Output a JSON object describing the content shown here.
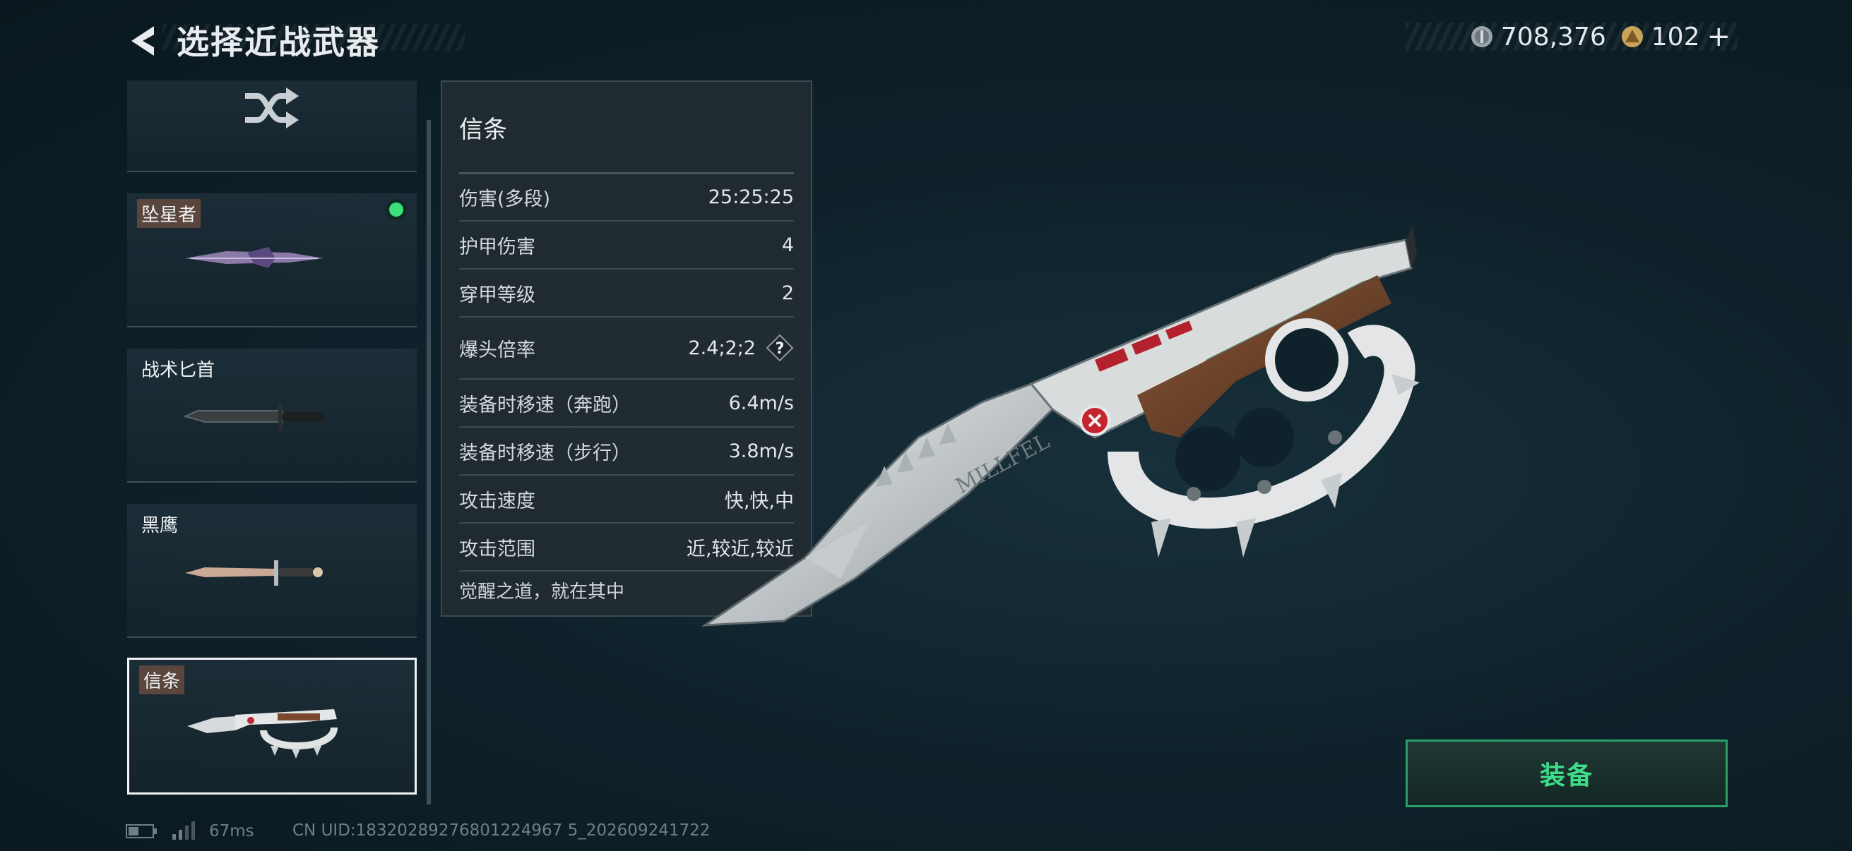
{
  "header": {
    "title": "选择近战武器"
  },
  "currency": {
    "silver": "708,376",
    "gold": "102"
  },
  "weapons": [
    {
      "name": "坠星者",
      "equipped": true,
      "selected": false,
      "icon": "purple-knife"
    },
    {
      "name": "战术匕首",
      "equipped": false,
      "selected": false,
      "icon": "tactical-knife"
    },
    {
      "name": "黑鹰",
      "equipped": false,
      "selected": false,
      "icon": "blackhawk-knife"
    },
    {
      "name": "信条",
      "equipped": false,
      "selected": true,
      "icon": "knuckle-knife"
    }
  ],
  "stats": {
    "title": "信条",
    "rows": [
      {
        "label": "伤害(多段)",
        "value": "25:25:25"
      },
      {
        "label": "护甲伤害",
        "value": "4"
      },
      {
        "label": "穿甲等级",
        "value": "2"
      },
      {
        "label": "爆头倍率",
        "value": "2.4;2;2",
        "help": true
      },
      {
        "label": "装备时移速（奔跑）",
        "value": "6.4m/s"
      },
      {
        "label": "装备时移速（步行）",
        "value": "3.8m/s"
      },
      {
        "label": "攻击速度",
        "value": "快,快,中"
      },
      {
        "label": "攻击范围",
        "value": "近,较近,较近"
      }
    ],
    "flavor": "觉醒之道，就在其中"
  },
  "weapon_engraving": "MILLFEL",
  "equip_button": "装备",
  "footer": {
    "ping": "67ms",
    "uid": "CN UID:18320289276801224967 5_202609241722"
  },
  "colors": {
    "accent_green": "#3fdc8c",
    "equipped_dot": "#3be07c",
    "name_tag": "#5a463d"
  }
}
